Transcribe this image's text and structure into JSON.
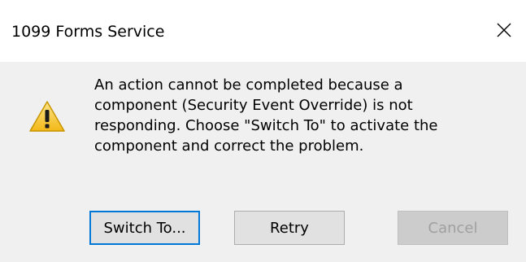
{
  "window": {
    "title": "1099 Forms Service"
  },
  "icons": {
    "close": "close-icon",
    "warning": "warning-icon",
    "warning_color": "#f7c948"
  },
  "message": {
    "lines": [
      "An action cannot be completed because a",
      "component (Security Event Override) is not",
      "responding.  Choose \"Switch To\" to activate the",
      "component and correct the problem."
    ]
  },
  "buttons": {
    "switch_to": "Switch To...",
    "retry": "Retry",
    "cancel": "Cancel"
  }
}
